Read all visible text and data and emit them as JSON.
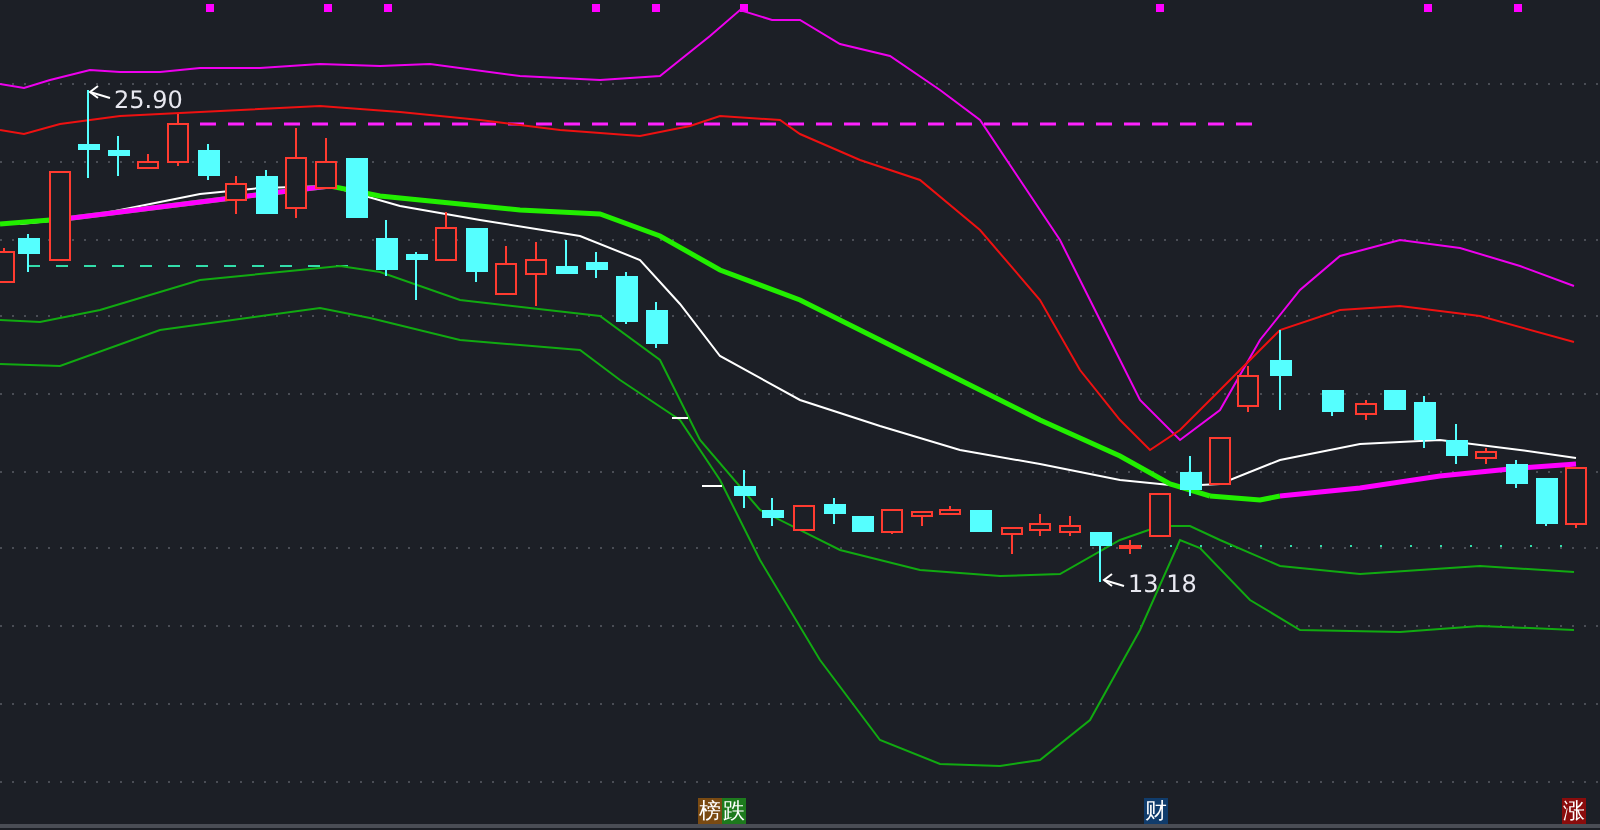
{
  "price_marks": [
    {
      "kind": "high",
      "text": "25.90"
    },
    {
      "kind": "low",
      "text": "13.18"
    }
  ],
  "event_tags": [
    {
      "text": "榜",
      "color": "#7a4a12"
    },
    {
      "text": "跌",
      "color": "#1d7a1d"
    },
    {
      "text": "财",
      "color": "#103c6c"
    },
    {
      "text": "涨",
      "color": "#8a0c0c"
    }
  ]
}
